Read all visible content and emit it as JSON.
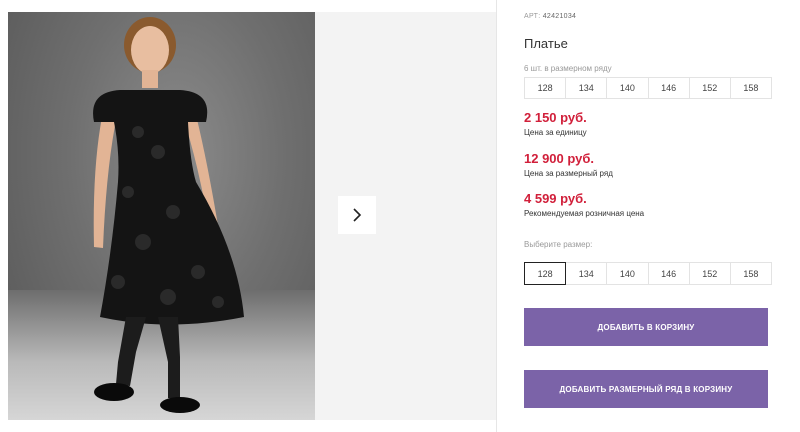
{
  "product": {
    "sku_label": "АРТ:",
    "sku": "42421034",
    "title": "Платье",
    "pack_label": "6 шт. в размерном ряду",
    "pack_sizes": [
      "128",
      "134",
      "140",
      "146",
      "152",
      "158"
    ],
    "unit_price": "2 150 руб.",
    "unit_price_label": "Цена за единицу",
    "pack_price": "12 900 руб.",
    "pack_price_label": "Цена за размерный ряд",
    "retail_price": "4 599 руб.",
    "retail_price_label": "Рекомендуемая розничная цена",
    "choose_size_label": "Выберите размер:",
    "sizes": [
      "128",
      "134",
      "140",
      "146",
      "152",
      "158"
    ],
    "selected_size": "128",
    "add_to_cart_label": "ДОБАВИТЬ В КОРЗИНУ",
    "add_pack_label": "ДОБАВИТЬ РАЗМЕРНЫЙ РЯД В КОРЗИНУ"
  },
  "colors": {
    "price": "#d11f3a",
    "button": "#7b63a8"
  },
  "icons": {
    "next": "chevron-right-icon"
  }
}
